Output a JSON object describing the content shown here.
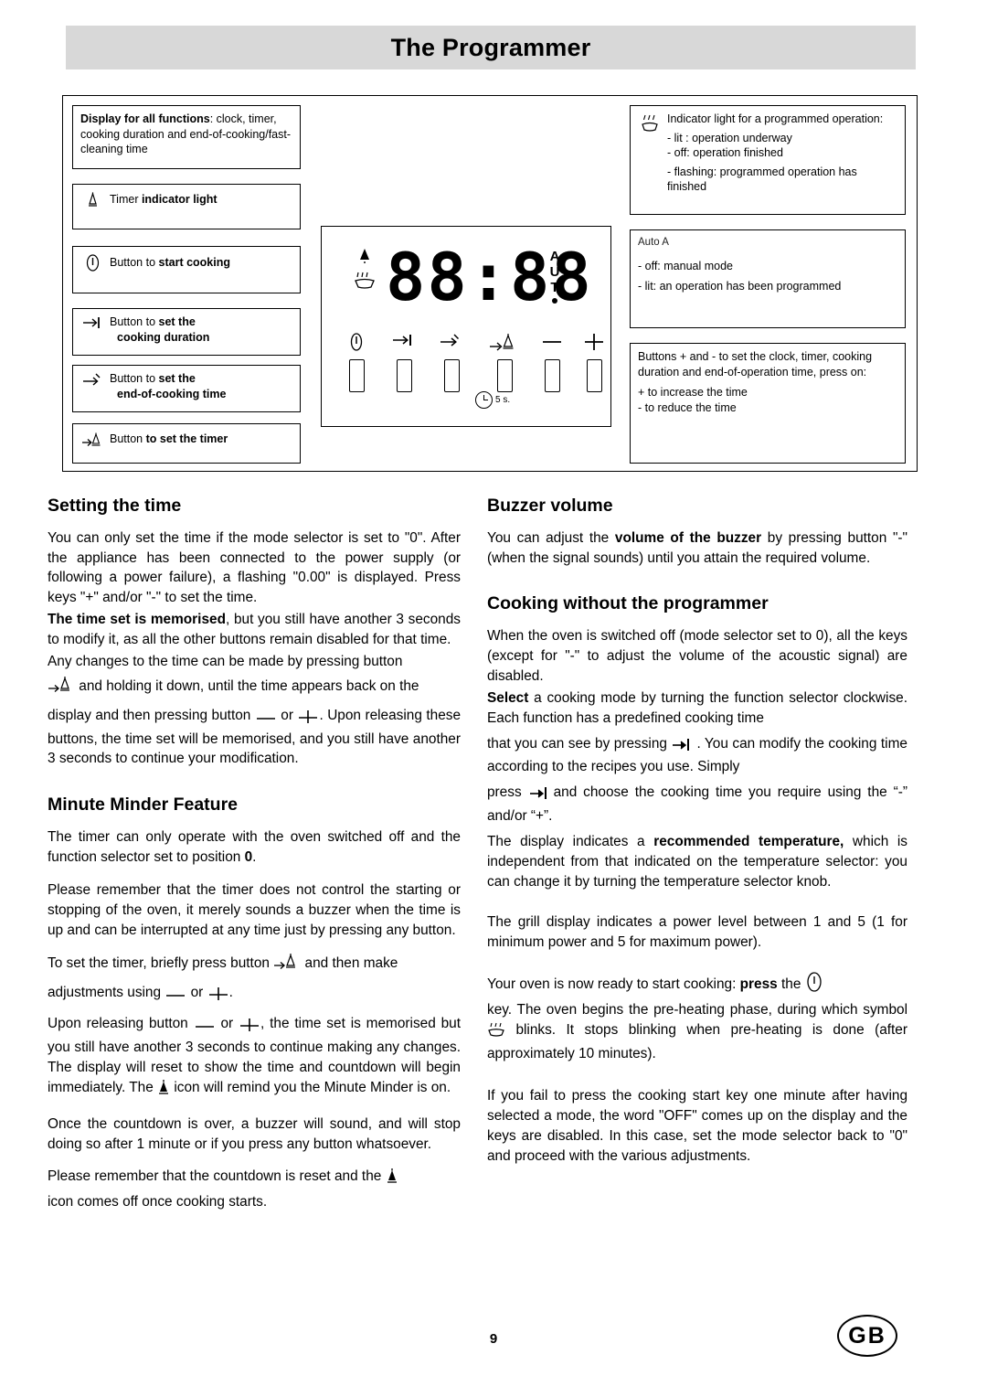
{
  "page": {
    "title": "The Programmer",
    "number": "9",
    "region_code": "GB"
  },
  "diagram": {
    "callouts": {
      "display": {
        "bold": "Display for all functions",
        "rest": ": clock, timer, cooking duration and end-of-cooking/fast-cleaning time"
      },
      "timer_light": {
        "pre": "Timer ",
        "bold": "indicator light",
        "icon": "bell-icon"
      },
      "start_cooking": {
        "pre": "Button to ",
        "bold": "start cooking",
        "icon": "power-icon"
      },
      "cooking_duration": {
        "pre": "Button to ",
        "bold": "set the",
        "bold2": "cooking duration",
        "icon": "duration-icon"
      },
      "end_of_cooking": {
        "pre": "Button to ",
        "bold": "set the",
        "bold2": "end-of-cooking time",
        "icon": "end-of-cooking-icon"
      },
      "set_timer": {
        "pre": "Button ",
        "bold": "to set the timer",
        "icon": "timer-bell-icon"
      },
      "indicator_light": {
        "line1": "Indicator light for a programmed operation:",
        "line2": "- lit : operation underway",
        "line3": "- off: operation finished",
        "line4": "- flashing: programmed operation has finished",
        "icon": "pot-heat-icon"
      },
      "auto_a": {
        "label": "Auto A",
        "line1": "- off: manual mode",
        "line2": "- lit: an operation has been programmed"
      },
      "plus_minus": {
        "line1": "Buttons + and - to set the clock, timer, cooking duration and end-of-operation time, press on:",
        "line2": "+ to increase the time",
        "line3": "- to reduce the time"
      }
    },
    "panel": {
      "lcd_value": "88:88",
      "lcd_right_symbol": "A U T",
      "five_seconds_label": "5 s.",
      "buttons": [
        {
          "name": "start-cooking-key",
          "glyph": "power-icon"
        },
        {
          "name": "cooking-duration-key",
          "glyph": "duration-icon"
        },
        {
          "name": "end-of-cooking-key",
          "glyph": "end-of-cooking-icon"
        },
        {
          "name": "timer-key",
          "glyph": "timer-bell-icon"
        },
        {
          "name": "minus-key",
          "glyph": "minus-icon"
        },
        {
          "name": "plus-key",
          "glyph": "plus-icon"
        }
      ]
    }
  },
  "left_column": {
    "heading_setting_time": "Setting the time",
    "p1": "You can only set the time if the mode selector is set to \"0\". After the appliance has been connected to the power supply (or following a power failure), a flashing \"0.00\" is displayed. Press keys \"+\" and/or \"-\" to set the time.",
    "p2_bold": "The time set is memorised",
    "p2_rest": ", but you still have another 3 seconds to modify it, as all the other buttons remain disabled for that time.",
    "p3a": "Any changes to the time can be made by pressing button",
    "p3b": "and holding it down, until the time appears back on the",
    "p3c": "display and then pressing button",
    "p3d": "or",
    "p3e": ". Upon releasing these buttons, the time set will be memorised, and you still have another 3 seconds to continue your modification.",
    "heading_minute_minder": "Minute Minder Feature",
    "p4a": "The timer can only operate with the oven switched off and the function selector set to position ",
    "p4b": "0",
    "p4c": ".",
    "p5": "Please remember that the timer does not control the starting or stopping of the oven, it merely sounds a buzzer when the time is up and can be interrupted at any time just by pressing any button.",
    "p6a": "To set the timer, briefly press button",
    "p6b": "and then make",
    "p6c": "adjustments using",
    "p6d": "or",
    "p7a": "Upon releasing button",
    "p7b": "or",
    "p7c": ", the time set is memorised but you still have another 3 seconds to continue making any changes. The display will reset to show the time and countdown will begin immediately. The",
    "p7d": "icon will remind you the Minute Minder is on.",
    "p8": "Once the countdown is over, a buzzer will sound, and will stop doing so after 1 minute or if you press any button whatsoever.",
    "p9a": "Please remember that the countdown is reset and the",
    "p9b": "icon comes off once cooking starts."
  },
  "right_column": {
    "heading_buzzer": "Buzzer volume",
    "b1a": "You can adjust the ",
    "b1b": "volume of the buzzer",
    "b1c": " by pressing button \"-\" (when the signal sounds) until you attain the required volume.",
    "heading_cooking_without": "Cooking without the programmer",
    "c1": "When the oven is switched off (mode selector set to 0), all the keys (except for \"-\" to adjust the volume of the acoustic signal) are disabled.",
    "c2_bold": "Select",
    "c2_rest": " a cooking mode by turning the function selector clockwise. Each function has a predefined cooking time",
    "c3a": "that you can see by pressing",
    "c3b": ". You can modify the cooking time according to the recipes you use.  Simply",
    "c4a": "press",
    "c4b": "and choose the cooking time you require using the “-” and/or “+”.",
    "c5a": "The display indicates a ",
    "c5b": "recommended temperature,",
    "c5c": " which is independent from that indicated on the temperature selector: you can change it by turning the temperature selector knob.",
    "c6": "The grill display indicates a power level between 1 and 5 (1 for minimum power and 5 for maximum power).",
    "c7a": "Your oven is now ready to start cooking: ",
    "c7b": "press",
    "c7c": " the",
    "c7d": "key. The oven begins the pre-heating phase, during which symbol",
    "c7e": "blinks. It stops blinking when pre-heating is done (after approximately 10 minutes).",
    "c8": "If you fail to press the cooking start key one minute after having selected a mode, the word \"OFF\" comes up on the display and the keys are disabled. In this case, set the mode selector back to \"0\" and proceed with the various adjustments."
  }
}
